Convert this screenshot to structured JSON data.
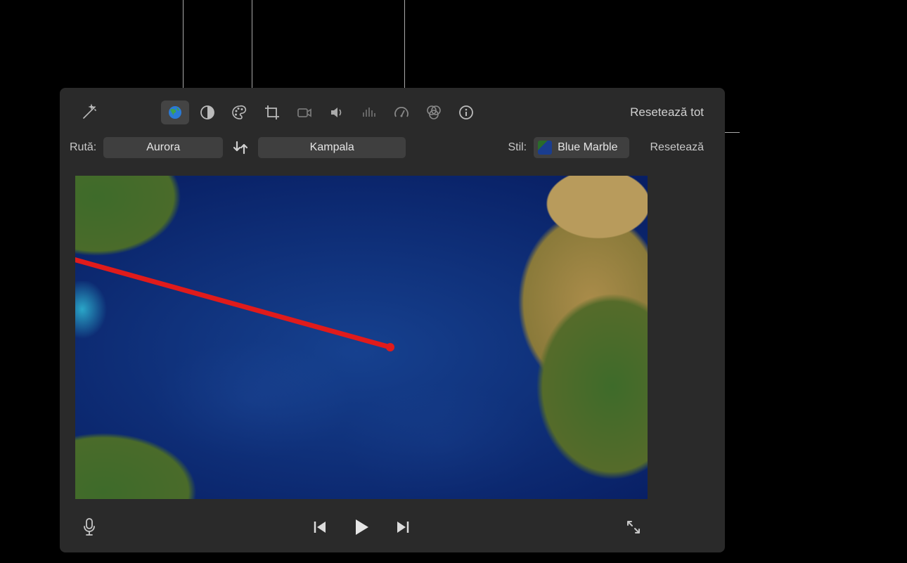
{
  "toolbar": {
    "reset_all": "Resetează tot",
    "icons": {
      "magic": "magic-wand-icon",
      "globe": "globe-icon",
      "exposure": "exposure-icon",
      "palette": "palette-icon",
      "crop": "crop-icon",
      "camera": "camera-icon",
      "volume": "volume-icon",
      "equalizer": "equalizer-icon",
      "speed": "speedometer-icon",
      "filters": "filters-icon",
      "info": "info-icon"
    }
  },
  "route": {
    "label": "Rută:",
    "start": "Aurora",
    "end": "Kampala"
  },
  "style": {
    "label": "Stil:",
    "value": "Blue Marble",
    "reset": "Resetează"
  },
  "transport": {
    "mic": "microphone-icon",
    "prev": "previous-icon",
    "play": "play-icon",
    "next": "next-icon",
    "fullscreen": "fullscreen-icon"
  }
}
